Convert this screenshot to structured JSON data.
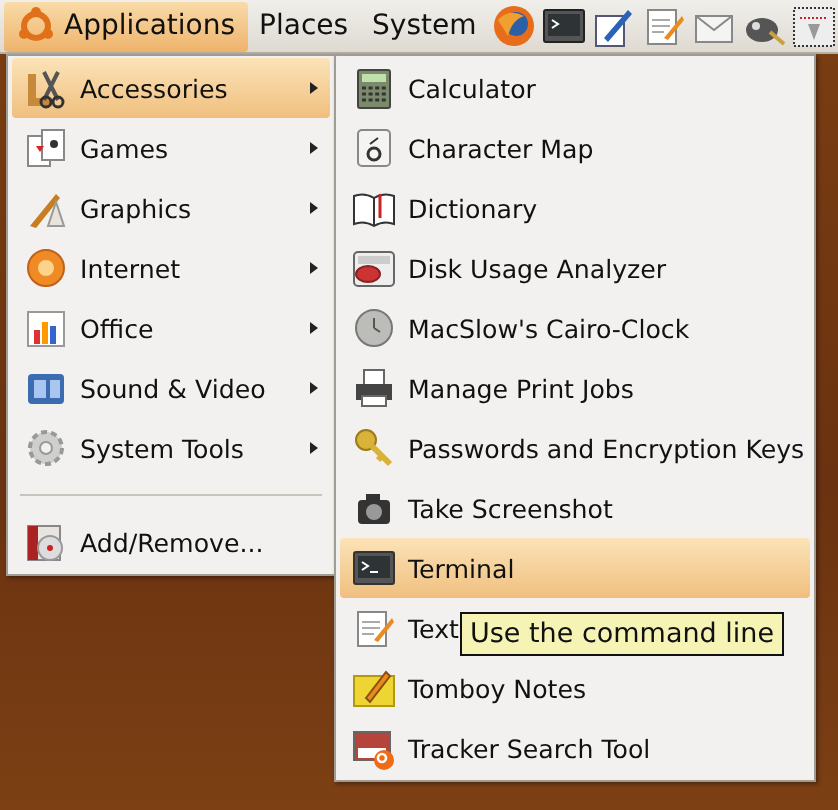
{
  "panel": {
    "menus": [
      {
        "label": "Applications",
        "selected": true
      },
      {
        "label": "Places",
        "selected": false
      },
      {
        "label": "System",
        "selected": false
      }
    ]
  },
  "applications_menu": {
    "items": [
      {
        "kind": "submenu",
        "label": "Accessories",
        "selected": true
      },
      {
        "kind": "submenu",
        "label": "Games",
        "selected": false
      },
      {
        "kind": "submenu",
        "label": "Graphics",
        "selected": false
      },
      {
        "kind": "submenu",
        "label": "Internet",
        "selected": false
      },
      {
        "kind": "submenu",
        "label": "Office",
        "selected": false
      },
      {
        "kind": "submenu",
        "label": "Sound & Video",
        "selected": false
      },
      {
        "kind": "submenu",
        "label": "System Tools",
        "selected": false
      },
      {
        "kind": "separator"
      },
      {
        "kind": "item",
        "label": "Add/Remove...",
        "selected": false
      }
    ]
  },
  "accessories_menu": {
    "items": [
      {
        "kind": "item",
        "label": "Calculator",
        "selected": false
      },
      {
        "kind": "item",
        "label": "Character Map",
        "selected": false
      },
      {
        "kind": "item",
        "label": "Dictionary",
        "selected": false
      },
      {
        "kind": "item",
        "label": "Disk Usage Analyzer",
        "selected": false
      },
      {
        "kind": "item",
        "label": "MacSlow's Cairo-Clock",
        "selected": false
      },
      {
        "kind": "item",
        "label": "Manage Print Jobs",
        "selected": false
      },
      {
        "kind": "item",
        "label": "Passwords and Encryption Keys",
        "selected": false
      },
      {
        "kind": "item",
        "label": "Take Screenshot",
        "selected": false
      },
      {
        "kind": "item",
        "label": "Terminal",
        "selected": true
      },
      {
        "kind": "item",
        "label": "Text",
        "selected": false
      },
      {
        "kind": "item",
        "label": "Tomboy Notes",
        "selected": false
      },
      {
        "kind": "item",
        "label": "Tracker Search Tool",
        "selected": false
      }
    ]
  },
  "tooltip": {
    "text": "Use the command line"
  }
}
